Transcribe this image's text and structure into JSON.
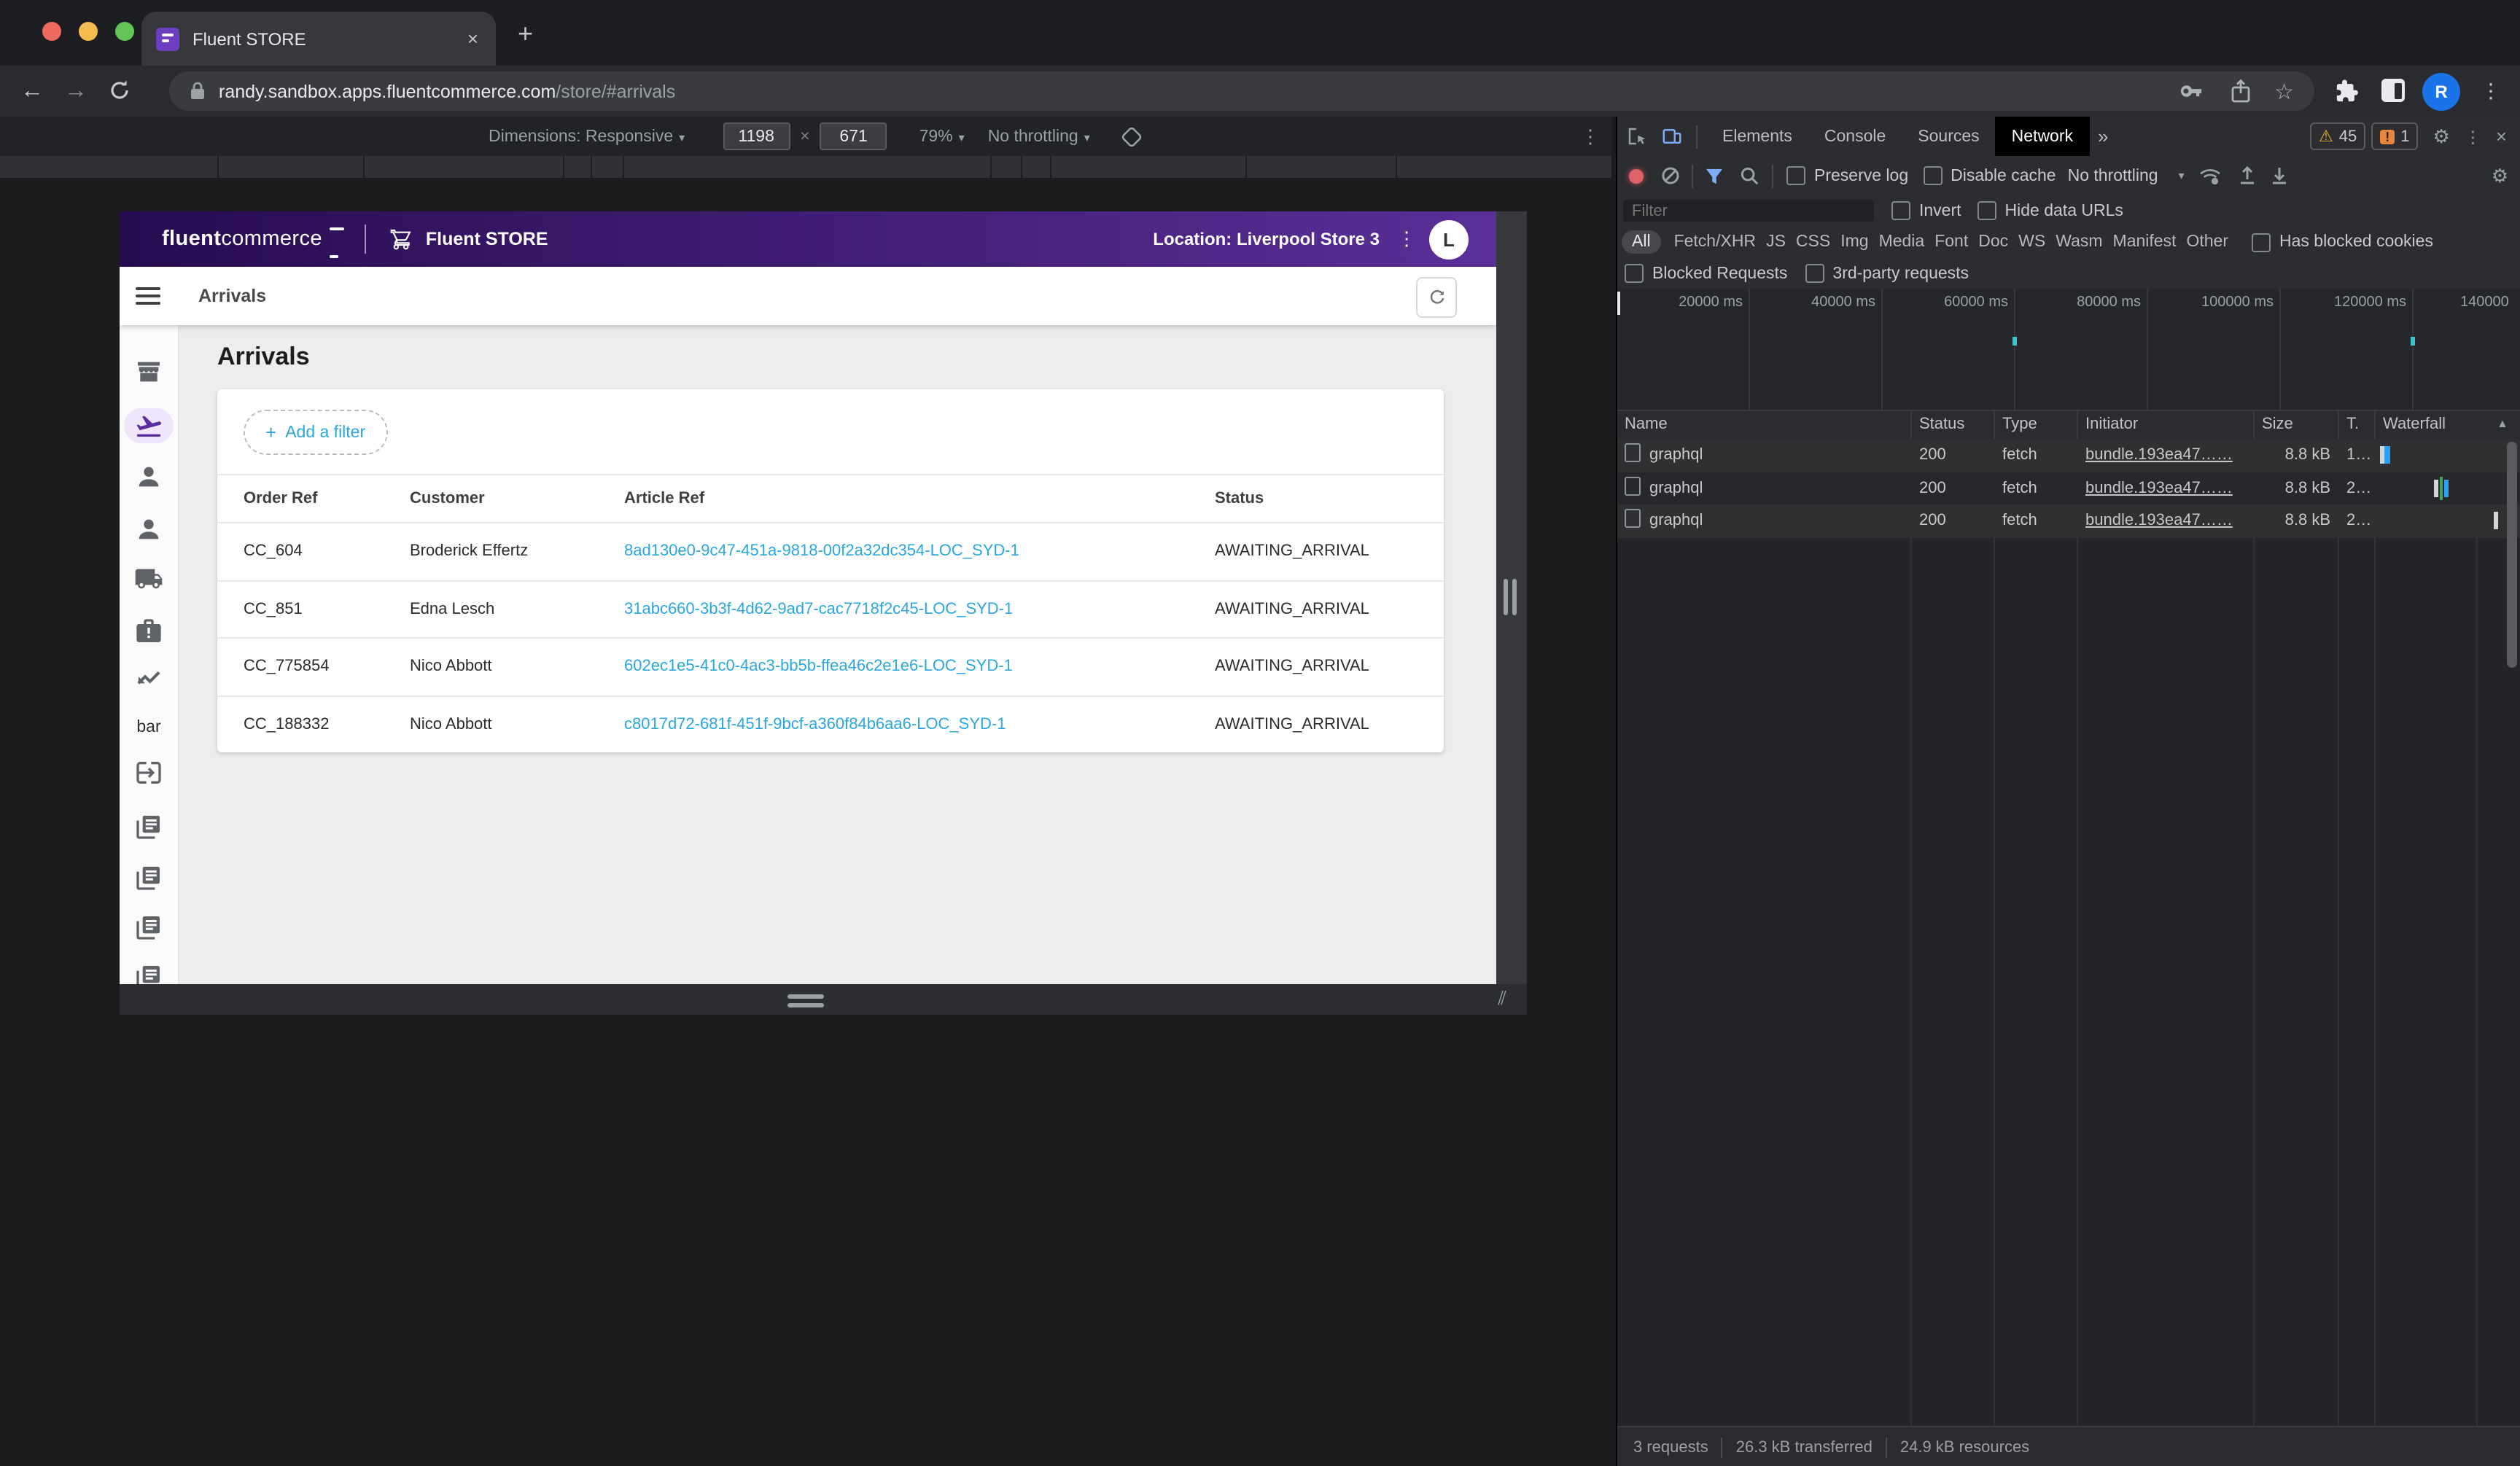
{
  "browser": {
    "tab_title": "Fluent STORE",
    "close_tab": "×",
    "new_tab": "+",
    "back": "←",
    "forward": "→",
    "url_domain": "randy.sandbox.apps.fluentcommerce.com",
    "url_path": "/store/#arrivals",
    "profile_initial": "R",
    "kebab": "⋮",
    "device_toolbar": {
      "dimensions_label": "Dimensions: Responsive",
      "caret": "▾",
      "width": "1198",
      "times": "×",
      "height": "671",
      "zoom": "79%",
      "throttling": "No throttling"
    }
  },
  "app": {
    "header": {
      "logo": "fluent",
      "logo2": "commerce",
      "store_name": "Fluent STORE",
      "location": "Location: Liverpool Store 3",
      "kebab": "⋮",
      "avatar_initial": "L"
    },
    "appbar_title": "Arrivals",
    "page_title": "Arrivals",
    "add_filter": "Add a filter",
    "add_filter_plus": "+",
    "sidebar_bar_label": "bar",
    "table": {
      "headers": [
        "Order Ref",
        "Customer",
        "Article Ref",
        "Status"
      ],
      "rows": [
        {
          "order_ref": "CC_604",
          "customer": "Broderick Effertz",
          "article_ref": "8ad130e0-9c47-451a-9818-00f2a32dc354-LOC_SYD-1",
          "status": "AWAITING_ARRIVAL"
        },
        {
          "order_ref": "CC_851",
          "customer": "Edna Lesch",
          "article_ref": "31abc660-3b3f-4d62-9ad7-cac7718f2c45-LOC_SYD-1",
          "status": "AWAITING_ARRIVAL"
        },
        {
          "order_ref": "CC_775854",
          "customer": "Nico Abbott",
          "article_ref": "602ec1e5-41c0-4ac3-bb5b-ffea46c2e1e6-LOC_SYD-1",
          "status": "AWAITING_ARRIVAL"
        },
        {
          "order_ref": "CC_188332",
          "customer": "Nico Abbott",
          "article_ref": "c8017d72-681f-451f-9bcf-a360f84b6aa6-LOC_SYD-1",
          "status": "AWAITING_ARRIVAL"
        }
      ]
    },
    "colors": {
      "brand_purple_dark": "#270c50",
      "brand_purple_light": "#5a2f97",
      "link_blue": "#2aa7dd",
      "active_purple": "#5b2da0"
    }
  },
  "devtools": {
    "tabs": [
      "Elements",
      "Console",
      "Sources",
      "Network"
    ],
    "more_tabs": "»",
    "warning_icon": "⚠",
    "warning_count": "45",
    "issue_count": "1",
    "close": "×",
    "kebab": "⋮",
    "gear": "⚙",
    "toolbar": {
      "preserve_log": "Preserve log",
      "disable_cache": "Disable cache",
      "throttling": "No throttling",
      "caret": "▾"
    },
    "filter": {
      "placeholder": "Filter",
      "invert": "Invert",
      "hide_data_urls": "Hide data URLs"
    },
    "chips": [
      "All",
      "Fetch/XHR",
      "JS",
      "CSS",
      "Img",
      "Media",
      "Font",
      "Doc",
      "WS",
      "Wasm",
      "Manifest",
      "Other"
    ],
    "has_blocked_cookies": "Has blocked cookies",
    "blocked_requests": "Blocked Requests",
    "third_party_requests": "3rd-party requests",
    "timeline_ticks": [
      "20000 ms",
      "40000 ms",
      "60000 ms",
      "80000 ms",
      "100000 ms",
      "120000 ms",
      "140000"
    ],
    "grid_headers": {
      "name": "Name",
      "status": "Status",
      "type": "Type",
      "initiator": "Initiator",
      "size": "Size",
      "time": "T.",
      "waterfall": "Waterfall",
      "sort": "▲"
    },
    "requests": [
      {
        "name": "graphql",
        "status": "200",
        "type": "fetch",
        "initiator": "bundle.193ea47……",
        "size": "8.8 kB",
        "time": "1…"
      },
      {
        "name": "graphql",
        "status": "200",
        "type": "fetch",
        "initiator": "bundle.193ea47……",
        "size": "8.8 kB",
        "time": "2…"
      },
      {
        "name": "graphql",
        "status": "200",
        "type": "fetch",
        "initiator": "bundle.193ea47……",
        "size": "8.8 kB",
        "time": "2…"
      }
    ],
    "summary": {
      "requests": "3 requests",
      "transferred": "26.3 kB transferred",
      "resources": "24.9 kB resources"
    }
  }
}
